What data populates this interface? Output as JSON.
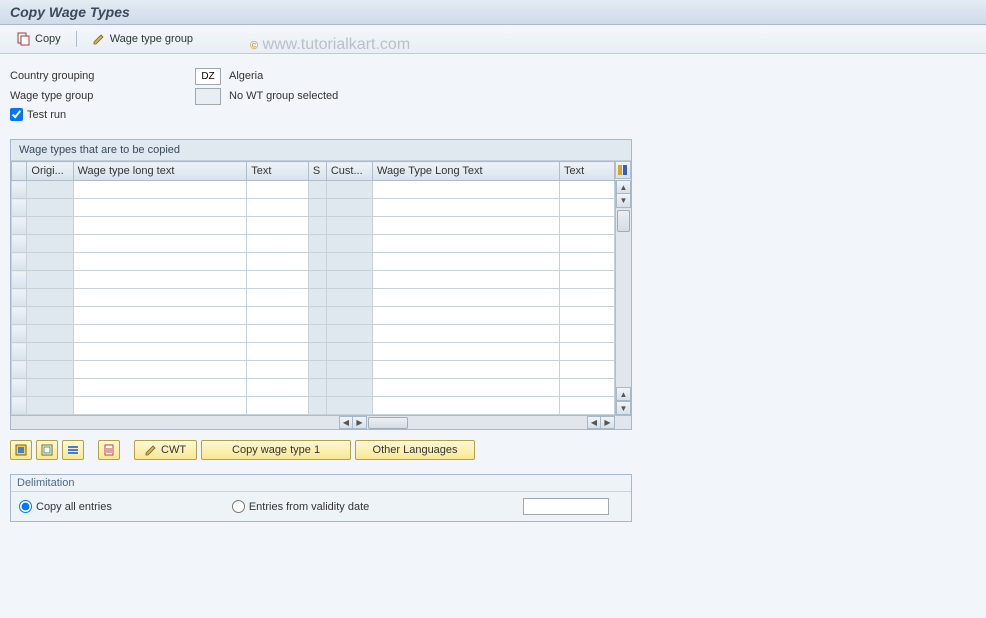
{
  "title": "Copy Wage Types",
  "toolbar": {
    "copy": "Copy",
    "wage_type_group": "Wage type group"
  },
  "watermark": "© www.tutorialkart.com",
  "form": {
    "country_grouping_label": "Country grouping",
    "country_grouping_value": "DZ",
    "country_grouping_desc": "Algeria",
    "wage_type_group_label": "Wage type group",
    "wage_type_group_value": "",
    "wage_type_group_desc": "No WT group selected",
    "test_run_label": "Test run",
    "test_run_checked": true
  },
  "table": {
    "title": "Wage types that are to be copied",
    "columns": {
      "c1": "Origi...",
      "c2": "Wage type long text",
      "c3": "Text",
      "c4": "S",
      "c5": "Cust...",
      "c6": "Wage Type Long Text",
      "c7": "Text"
    },
    "row_count": 13
  },
  "buttons": {
    "cwt": "CWT",
    "copy_wt1": "Copy wage type 1",
    "other_lang": "Other Languages"
  },
  "delimitation": {
    "title": "Delimitation",
    "opt1": "Copy all entries",
    "opt2": "Entries from validity date",
    "selected": "opt1",
    "date_value": ""
  }
}
